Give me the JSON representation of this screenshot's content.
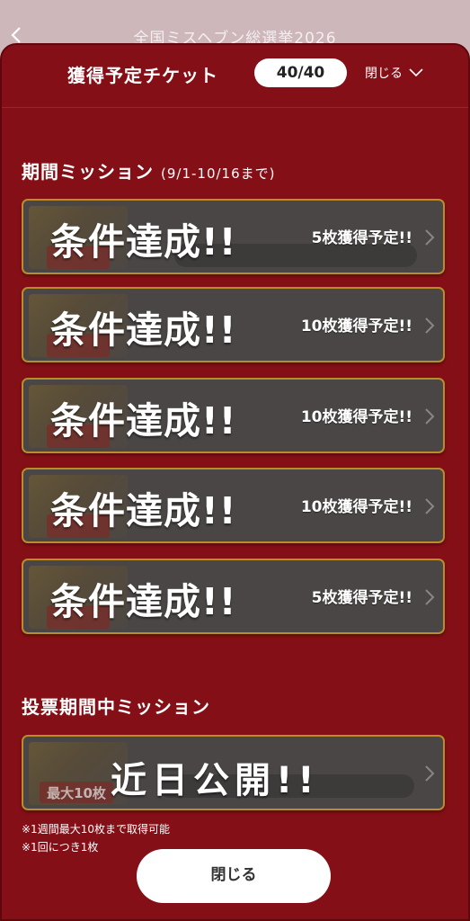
{
  "app_bar": {
    "title": "全国ミスヘブン総選挙2026"
  },
  "sheet": {
    "title": "獲得予定チケット",
    "ticket_count": "40/40",
    "close_label": "閉じる"
  },
  "period_missions": {
    "title": "期間ミッション",
    "period": "(9/1-10/16まで)",
    "items": [
      {
        "status": "条件達成!!",
        "reward": "5枚獲得予定!!"
      },
      {
        "status": "条件達成!!",
        "reward": "10枚獲得予定!!"
      },
      {
        "status": "条件達成!!",
        "reward": "10枚獲得予定!!"
      },
      {
        "status": "条件達成!!",
        "reward": "10枚獲得予定!!"
      },
      {
        "status": "条件達成!!",
        "reward": "5枚獲得予定!!"
      }
    ]
  },
  "voting_missions": {
    "title": "投票期間中ミッション",
    "items": [
      {
        "status": "近日公開!!",
        "badge": "最大10枚"
      }
    ]
  },
  "notes": [
    "※1週間最大10枚まで取得可能",
    "※1回につき1枚"
  ],
  "bottom_close_label": "閉じる",
  "colors": {
    "sheet_bg": "#850f16",
    "card_bg": "#4a4646",
    "card_border": "#b88d2a"
  }
}
